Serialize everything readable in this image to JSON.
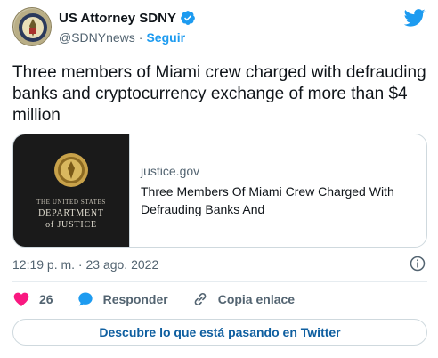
{
  "author": {
    "name": "US Attorney SDNY",
    "handle": "@SDNYnews",
    "separator": "·",
    "follow_label": "Seguir",
    "avatar_icon": "doj-seal-icon"
  },
  "tweet": {
    "text": "Three members of Miami crew charged with defrauding banks and cryptocurrency exchange of more than $4 million"
  },
  "card": {
    "image_lines": [
      "THE UNITED STATES",
      "DEPARTMENT",
      "of JUSTICE"
    ],
    "domain": "justice.gov",
    "title": "Three Members Of Miami Crew Charged With Defrauding Banks And"
  },
  "meta": {
    "timestamp": "12:19 p. m. · 23 ago. 2022"
  },
  "actions": {
    "likes_count": "26",
    "reply_label": "Responder",
    "copy_label": "Copia enlace"
  },
  "discover_label": "Descubre lo que está pasando en Twitter",
  "colors": {
    "accent": "#1d9bf0",
    "heart": "#f91880",
    "text": "#0f1419",
    "muted": "#536471"
  }
}
